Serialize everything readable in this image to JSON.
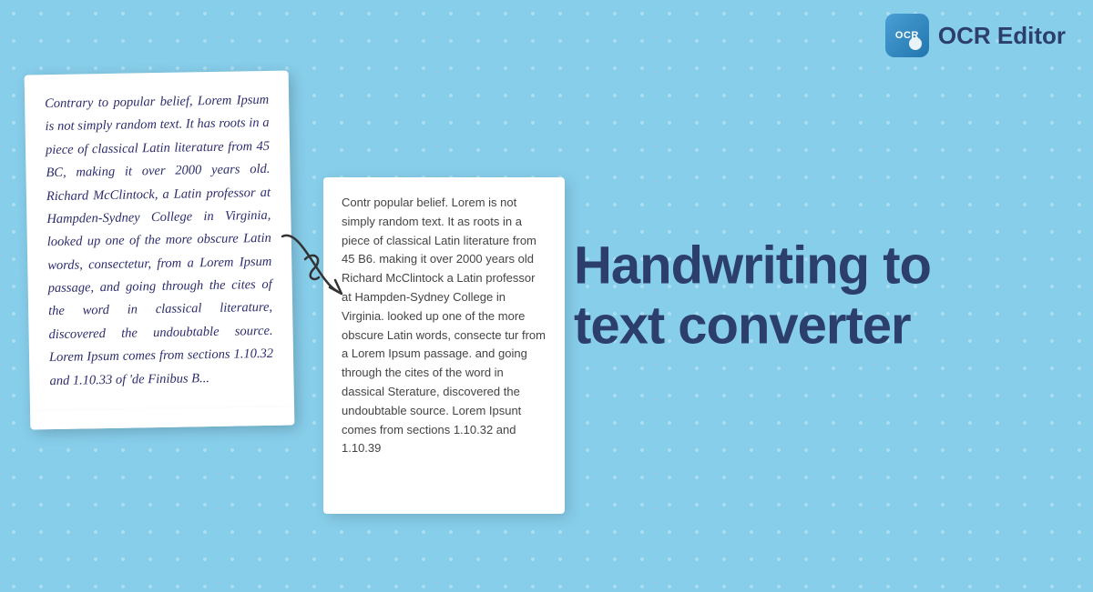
{
  "header": {
    "logo_text": "OCR",
    "app_title": "OCR Editor"
  },
  "handwriting": {
    "text": "Contrary to popular belief, Lorem Ipsum is not simply random text. It has roots in a piece of classical Latin literature from 45 BC, making it over 2000 years old. Richard McClintock, a Latin professor at Hampden-Sydney College in Virginia, looked up one of the more obscure Latin words, consectetur, from a Lorem Ipsum passage, and going through the cites of the word in classical literature, discovered the undoubtable source. Lorem Ipsum comes from sections 1.10.32 and 1.10.33 of 'de Finibus B..."
  },
  "ocr_output": {
    "text": "Contr popular belief. Lorem is not simply random text. It as roots in a piece of classical Latin literature from 45 B6. making it over 2000 years old Richard McClintock a Latin professor at Hampden-Sydney College in Virginia. looked up one of the more obscure Latin words, consecte tur from a Lorem Ipsum passage. and going through the cites of the word in dassical Sterature, discovered the undoubtable source. Lorem Ipsunt comes from sections 1.10.32 and 1.10.39"
  },
  "headline": {
    "line1": "Handwriting to",
    "line2": "text converter"
  },
  "colors": {
    "background": "#87CEEB",
    "text_dark": "#2C3E6B",
    "ocr_text": "#666"
  }
}
